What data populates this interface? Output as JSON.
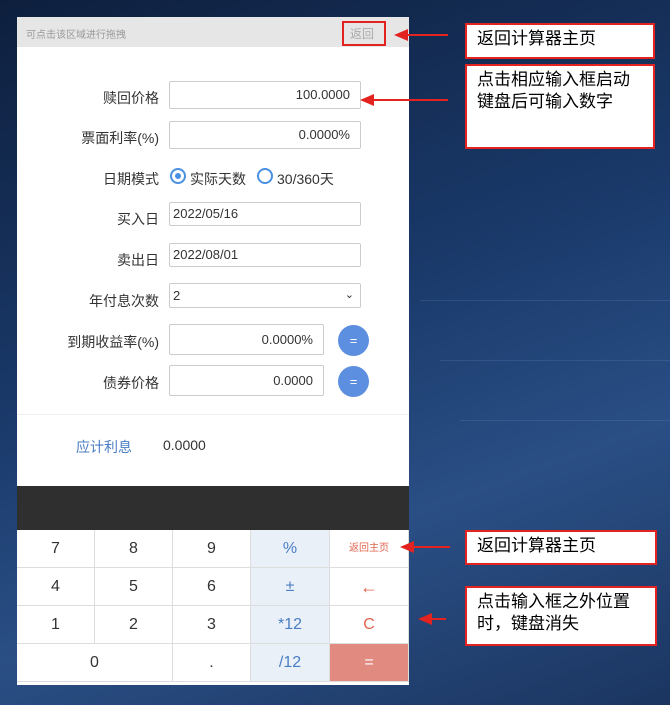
{
  "drag_area": {
    "hint": "可点击该区域进行拖拽",
    "back_label": "返回"
  },
  "form": {
    "redemption_price": {
      "label": "赎回价格",
      "value": "100.0000"
    },
    "coupon_rate": {
      "label": "票面利率(%)",
      "value": "0.0000%"
    },
    "date_mode": {
      "label": "日期模式",
      "options": [
        "实际天数",
        "30/360天"
      ],
      "selected": "实际天数"
    },
    "buy_date": {
      "label": "买入日",
      "value": "2022/05/16"
    },
    "sell_date": {
      "label": "卖出日",
      "value": "2022/08/01"
    },
    "annual_payments": {
      "label": "年付息次数",
      "value": "2"
    },
    "ytm": {
      "label": "到期收益率(%)",
      "value": "0.0000%",
      "button": "="
    },
    "bond_price": {
      "label": "债券价格",
      "value": "0.0000",
      "button": "="
    },
    "accrued_interest": {
      "label": "应计利息",
      "value": "0.0000"
    }
  },
  "keyboard": {
    "row1": [
      "7",
      "8",
      "9",
      "%",
      "返回主页"
    ],
    "row2": [
      "4",
      "5",
      "6",
      "±",
      "←"
    ],
    "row3": [
      "1",
      "2",
      "3",
      "*12",
      "C"
    ],
    "row4": [
      "0",
      ".",
      "/12",
      "="
    ]
  },
  "callouts": {
    "back_top": "返回计算器主页",
    "input_hint": "点击相应输入框启动键盘后可输入数字",
    "back_keyboard": "返回计算器主页",
    "dismiss_hint": "点击输入框之外位置时，键盘消失"
  },
  "colors": {
    "accent": "#4a90e2",
    "callout_red": "#e3231f",
    "equal_key": "#e08a80"
  }
}
